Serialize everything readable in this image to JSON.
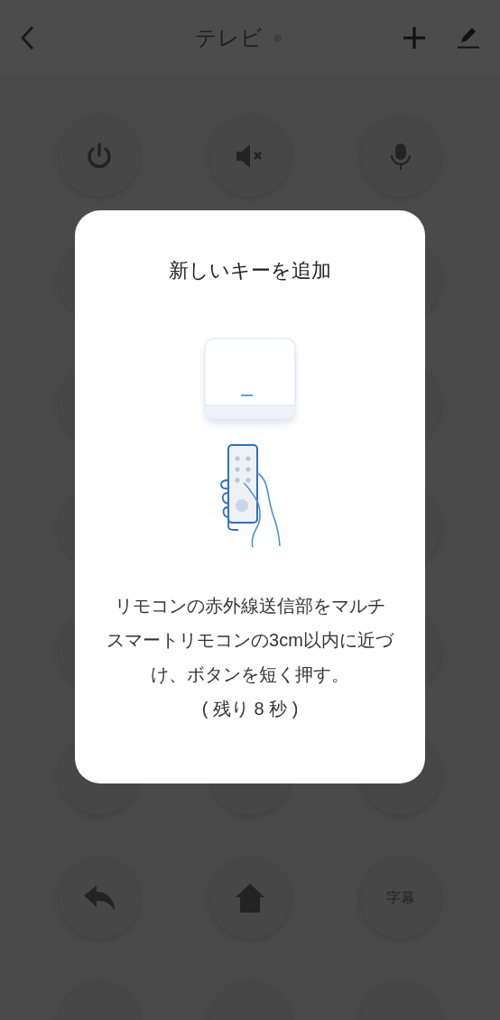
{
  "header": {
    "title": "テレビ",
    "connected": false
  },
  "keys": [
    {
      "kind": "power"
    },
    {
      "kind": "mute"
    },
    {
      "kind": "mic"
    },
    {
      "kind": "blank"
    },
    {
      "kind": "covered"
    },
    {
      "kind": "blank"
    },
    {
      "kind": "blank"
    },
    {
      "kind": "covered"
    },
    {
      "kind": "blank"
    },
    {
      "kind": "blank"
    },
    {
      "kind": "covered"
    },
    {
      "kind": "blank"
    },
    {
      "kind": "blank"
    },
    {
      "kind": "covered"
    },
    {
      "kind": "blank"
    },
    {
      "kind": "blank"
    },
    {
      "kind": "blank"
    },
    {
      "kind": "blank"
    },
    {
      "kind": "return"
    },
    {
      "kind": "home"
    },
    {
      "kind": "text",
      "label": "字幕"
    },
    {
      "kind": "blank"
    },
    {
      "kind": "blank"
    },
    {
      "kind": "blank"
    }
  ],
  "dialog": {
    "title": "新しいキーを追加",
    "instruction": "リモコンの赤外線送信部をマルチスマートリモコンの3cm以内に近づけ、ボタンを短く押す。",
    "countdown": "( 残り 8 秒 )"
  }
}
